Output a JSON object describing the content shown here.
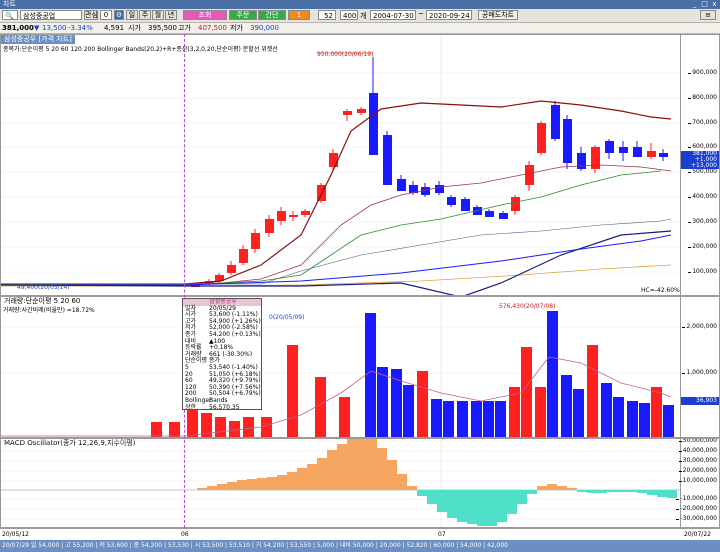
{
  "window": {
    "title": "차트",
    "min": "_",
    "max": "□",
    "close": "x"
  },
  "toolbar": {
    "code": "삼성중공업",
    "btn_a": "관심",
    "btn_b": "0",
    "btn_c": "일",
    "btn_d": "주",
    "btn_e": "월",
    "btn_f": "년",
    "btn_g": "틱",
    "btn_h": "분",
    "btn_i": "초",
    "btn_pink": "조회",
    "btn_green": "주문",
    "btn_green2": "간단",
    "btn_orange": "1",
    "num1": "52",
    "num2": "4000",
    "unit": "개",
    "date_from": "2004-07-30",
    "date_to": "2020-09-24",
    "btn_right": "공매도차트"
  },
  "quote": {
    "price": "381,000",
    "arrow": "▼",
    "change": "13,500",
    "rate": "-3.34%",
    "volume": "4,591",
    "open_label": "시가",
    "open": "395,500",
    "high_label": "고가",
    "high": "407,500",
    "low_label": "저가",
    "low": "390,000"
  },
  "price_panel": {
    "title": "삼성중공우 [가격 차트]",
    "legend": "종목가:단순이평 5 20 60 120 200  Bollinger Bands(20,2)+R+종산(3,2,0,20,단순이평)  분할선 위젯선",
    "y_labels": [
      "900,000",
      "800,000",
      "700,000",
      "600,000",
      "500,000",
      "400,000",
      "300,000",
      "200,000",
      "100,000"
    ],
    "current_tag": "381,000",
    "tag2": "+1,000",
    "tag3": "+13,000",
    "high_annot": "950,000(20/06/19)",
    "low_annot": "49,400(20/05/14)",
    "hc_label": "HC=-42.60%"
  },
  "volume_panel": {
    "title": "거래량:단순이평 5 20 60",
    "legend": "거래량:사간비례(비율만) =18.72%",
    "y_labels": [
      "2,000,000",
      "1,000,000"
    ],
    "current_tag": "36,903",
    "annot": "576,430(20/07/08)",
    "cross_label": "0(20/05/09)"
  },
  "macd_panel": {
    "title": "MACD Oscillator(종가 12,26,9,지수이평)",
    "y_labels": [
      "50,000,000",
      "40,000,000",
      "30,000,000",
      "20,000,000",
      "10,000,000",
      "-10,000,000",
      "-20,000,000",
      "-30,000,000"
    ]
  },
  "infobox": {
    "header": "삼성중공우",
    "rows": [
      [
        "일자",
        "20/05/29"
      ],
      [
        "시가",
        "53,600 (-1.11%)"
      ],
      [
        "고가",
        "54,900 (+1.26%)"
      ],
      [
        "저가",
        "52,000 (-2.58%)"
      ],
      [
        "종가",
        "54,200 (+0.13%)"
      ],
      [
        "대비",
        "▲100"
      ],
      [
        "등락률",
        "+0.18%"
      ],
      [
        "거래량",
        "661 (-30.30%)"
      ],
      [
        "단순이평",
        "종가"
      ],
      [
        "5",
        "53,540 (-1.40%)"
      ],
      [
        "20",
        "51,050 (+6.18%)"
      ],
      [
        "60",
        "49,320 (+9.79%)"
      ],
      [
        "120",
        "50,390 (+7.56%)"
      ],
      [
        "200",
        "50,504 (+6.79%)"
      ],
      [
        "Bollinger",
        "Bands"
      ],
      [
        "상한",
        "56,570.35"
      ],
      [
        "하한",
        "50,006.52"
      ]
    ]
  },
  "x_axis": {
    "labels": [
      "20/05/12",
      "06",
      "07",
      "20/07/22"
    ]
  },
  "status_text": "20/07/29 일 54,000 | 고 55,200 | 저 53,600 | 종 54,200 | 53,530 | 시 53,500 | 53,510 | 거 54,200 | 53,550 | 5,000 | 대비 50,000 | 20,000 | 52,820 | 60,000 | 54,000 | 42,000"
}
